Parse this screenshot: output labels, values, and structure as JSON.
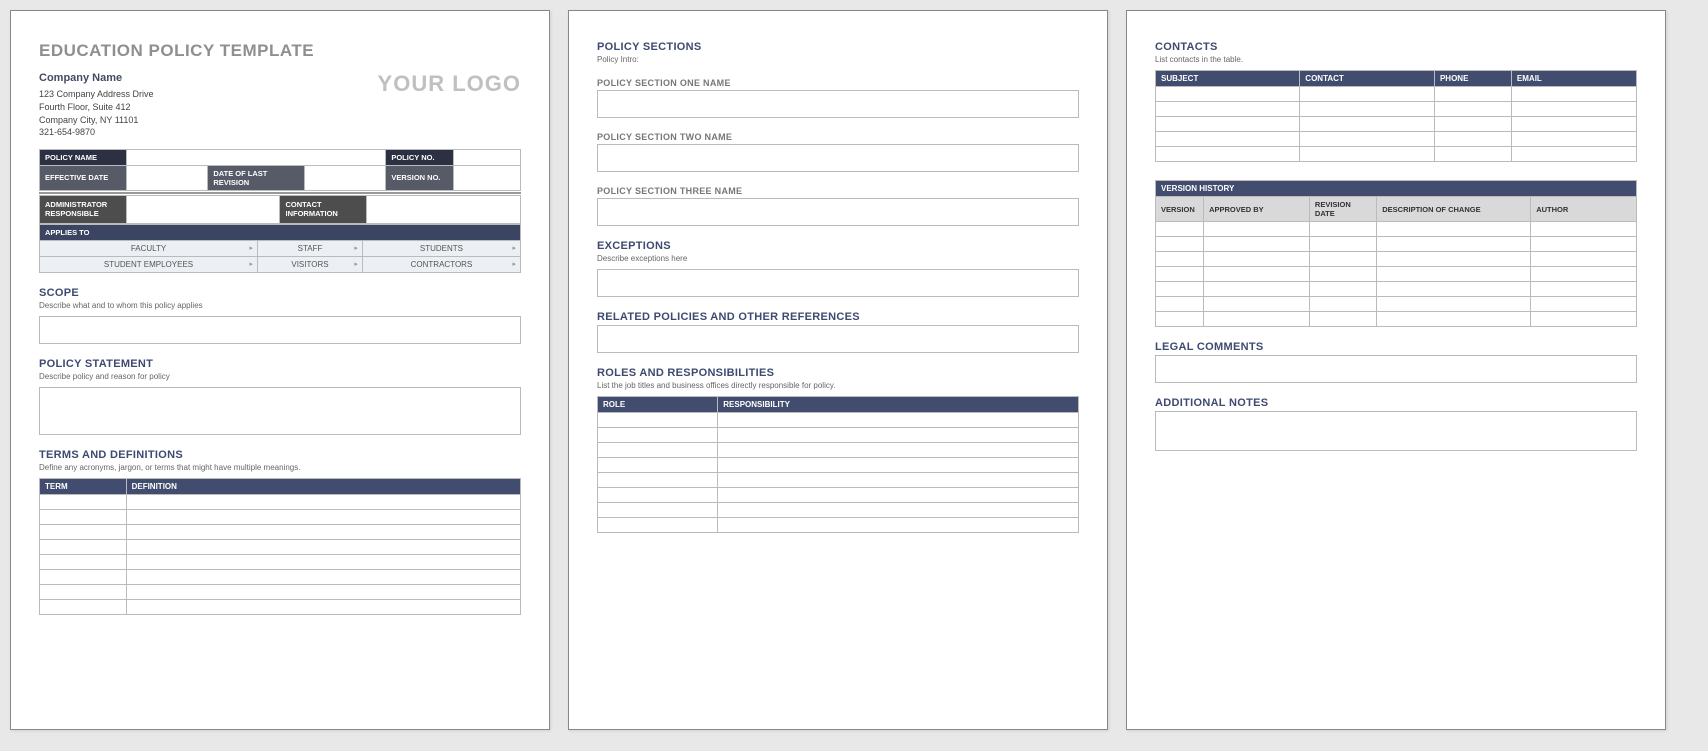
{
  "doc_title": "EDUCATION POLICY TEMPLATE",
  "company": {
    "name": "Company Name",
    "line1": "123 Company Address Drive",
    "line2": "Fourth Floor, Suite 412",
    "line3": "Company City, NY  11101",
    "phone": "321-654-9870"
  },
  "logo_text": "YOUR LOGO",
  "info": {
    "policy_name": "POLICY NAME",
    "policy_no": "POLICY NO.",
    "effective_date": "EFFECTIVE DATE",
    "date_last_rev": "DATE OF LAST REVISION",
    "version_no": "VERSION NO.",
    "admin_resp": "ADMINISTRATOR RESPONSIBLE",
    "contact_info": "CONTACT INFORMATION",
    "applies_to": "APPLIES TO"
  },
  "applies_options": [
    "FACULTY",
    "STAFF",
    "STUDENTS",
    "STUDENT EMPLOYEES",
    "VISITORS",
    "CONTRACTORS"
  ],
  "p1": {
    "scope": "SCOPE",
    "scope_sub": "Describe what and to whom this policy applies",
    "policy_stmt": "POLICY STATEMENT",
    "policy_stmt_sub": "Describe policy and reason for policy",
    "terms": "TERMS AND DEFINITIONS",
    "terms_sub": "Define any acronyms, jargon, or terms that might have multiple meanings.",
    "term_col": "TERM",
    "def_col": "DEFINITION"
  },
  "p2": {
    "policy_sections": "POLICY SECTIONS",
    "policy_intro": "Policy Intro:",
    "sec1": "POLICY SECTION ONE NAME",
    "sec2": "POLICY SECTION TWO NAME",
    "sec3": "POLICY SECTION THREE NAME",
    "exceptions": "EXCEPTIONS",
    "exceptions_sub": "Describe exceptions here",
    "related": "RELATED POLICIES AND OTHER REFERENCES",
    "roles": "ROLES AND RESPONSIBILITIES",
    "roles_sub": "List the job titles and business offices directly responsible for policy.",
    "role_col": "ROLE",
    "resp_col": "RESPONSIBILITY"
  },
  "p3": {
    "contacts": "CONTACTS",
    "contacts_sub": "List contacts in the table.",
    "c_subject": "SUBJECT",
    "c_contact": "CONTACT",
    "c_phone": "PHONE",
    "c_email": "EMAIL",
    "version_history": "VERSION HISTORY",
    "v_version": "VERSION",
    "v_approved": "APPROVED BY",
    "v_revdate": "REVISION DATE",
    "v_desc": "DESCRIPTION OF CHANGE",
    "v_author": "AUTHOR",
    "legal": "LEGAL COMMENTS",
    "notes": "ADDITIONAL NOTES"
  }
}
